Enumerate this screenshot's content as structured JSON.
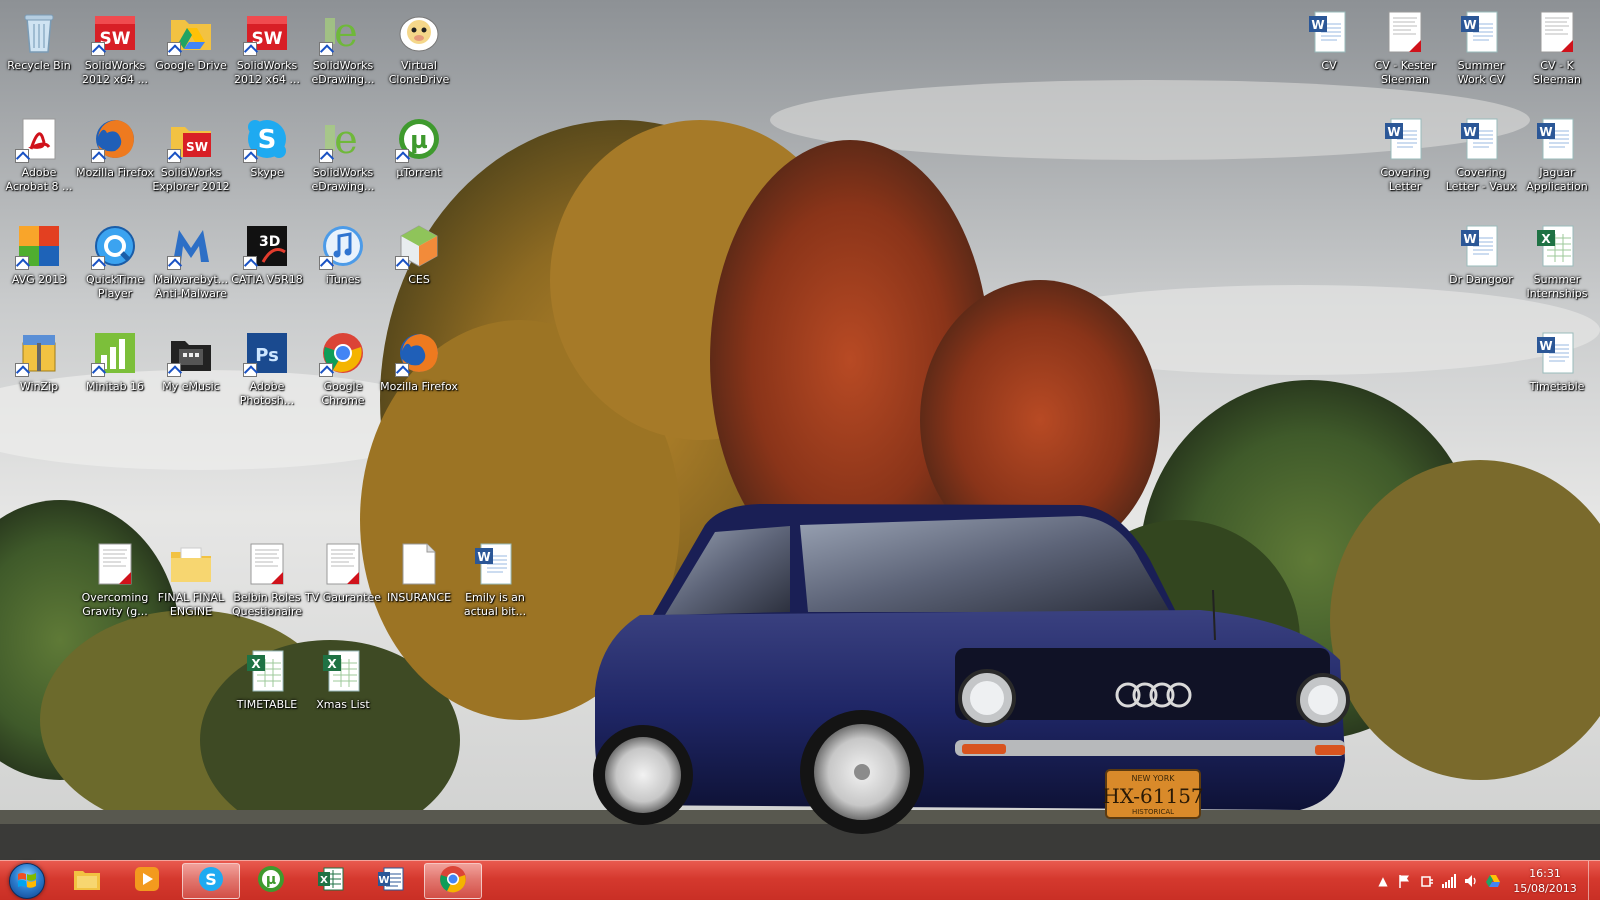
{
  "desktop": {
    "left_icons": [
      {
        "label": "Recycle Bin",
        "icon": "recycle-bin"
      },
      {
        "label": "SolidWorks 2012 x64 ...",
        "icon": "solidworks"
      },
      {
        "label": "Google Drive",
        "icon": "google-drive"
      },
      {
        "label": "SolidWorks 2012 x64 ...",
        "icon": "solidworks"
      },
      {
        "label": "SolidWorks eDrawing...",
        "icon": "edrawings"
      },
      {
        "label": "Virtual CloneDrive",
        "icon": "clonedrive"
      },
      {
        "label": "Adobe Acrobat 8 ...",
        "icon": "acrobat"
      },
      {
        "label": "Mozilla Firefox",
        "icon": "firefox"
      },
      {
        "label": "SolidWorks Explorer 2012",
        "icon": "solidworks-explorer"
      },
      {
        "label": "Skype",
        "icon": "skype"
      },
      {
        "label": "SolidWorks eDrawing...",
        "icon": "edrawings"
      },
      {
        "label": "µTorrent",
        "icon": "utorrent"
      },
      {
        "label": "AVG 2013",
        "icon": "avg"
      },
      {
        "label": "QuickTime Player",
        "icon": "quicktime"
      },
      {
        "label": "Malwarebyt... Anti-Malware",
        "icon": "malwarebytes"
      },
      {
        "label": "CATIA V5R18",
        "icon": "catia"
      },
      {
        "label": "iTunes",
        "icon": "itunes"
      },
      {
        "label": "CES",
        "icon": "ces"
      },
      {
        "label": "WinZip",
        "icon": "winzip"
      },
      {
        "label": "Minitab 16",
        "icon": "minitab"
      },
      {
        "label": "My eMusic",
        "icon": "emusic"
      },
      {
        "label": "Adobe Photosh...",
        "icon": "photoshop"
      },
      {
        "label": "Google Chrome",
        "icon": "chrome"
      },
      {
        "label": "Mozilla Firefox",
        "icon": "firefox"
      },
      {
        "label": "Overcoming Gravity (g...",
        "icon": "pdf-doc"
      },
      {
        "label": "FINAL FINAL ENGINE",
        "icon": "folder"
      },
      {
        "label": "Belbin Roles Questionaire",
        "icon": "pdf-doc"
      },
      {
        "label": "TV Gaurantee",
        "icon": "pdf-doc"
      },
      {
        "label": "INSURANCE",
        "icon": "blank-doc"
      },
      {
        "label": "Emily is an actual bit...",
        "icon": "word-doc"
      },
      {
        "label": "TIMETABLE",
        "icon": "excel-doc"
      },
      {
        "label": "Xmas List",
        "icon": "excel-doc"
      }
    ],
    "right_icons": [
      {
        "label": "CV",
        "icon": "word-doc"
      },
      {
        "label": "CV - Kester Sleeman",
        "icon": "pdf-doc"
      },
      {
        "label": "Summer Work CV",
        "icon": "word-doc"
      },
      {
        "label": "CV - K Sleeman",
        "icon": "pdf-doc"
      },
      {
        "label": "Covering Letter",
        "icon": "word-doc"
      },
      {
        "label": "Covering Letter - Vaux",
        "icon": "word-doc"
      },
      {
        "label": "Jaguar Application",
        "icon": "word-doc"
      },
      {
        "label": "Dr Dangoor",
        "icon": "word-doc"
      },
      {
        "label": "Summer Internships",
        "icon": "excel-doc"
      },
      {
        "label": "Timetable",
        "icon": "word-doc"
      }
    ],
    "wallpaper": {
      "plate_state": "NEW YORK",
      "plate_number": "HX-61157",
      "plate_footer": "HISTORICAL"
    }
  },
  "taskbar": {
    "color": "#d5392e",
    "pinned": [
      {
        "name": "explorer",
        "icon": "folder-icon",
        "active": false
      },
      {
        "name": "media-player",
        "icon": "media-player-icon",
        "active": false
      },
      {
        "name": "skype",
        "icon": "skype-icon",
        "active": true
      },
      {
        "name": "utorrent",
        "icon": "utorrent-icon",
        "active": false
      },
      {
        "name": "excel",
        "icon": "excel-icon",
        "active": false
      },
      {
        "name": "word",
        "icon": "word-icon",
        "active": false
      },
      {
        "name": "chrome",
        "icon": "chrome-icon",
        "active": true
      }
    ],
    "tray": {
      "show_hidden": "▲",
      "time": "16:31",
      "date": "15/08/2013"
    }
  }
}
